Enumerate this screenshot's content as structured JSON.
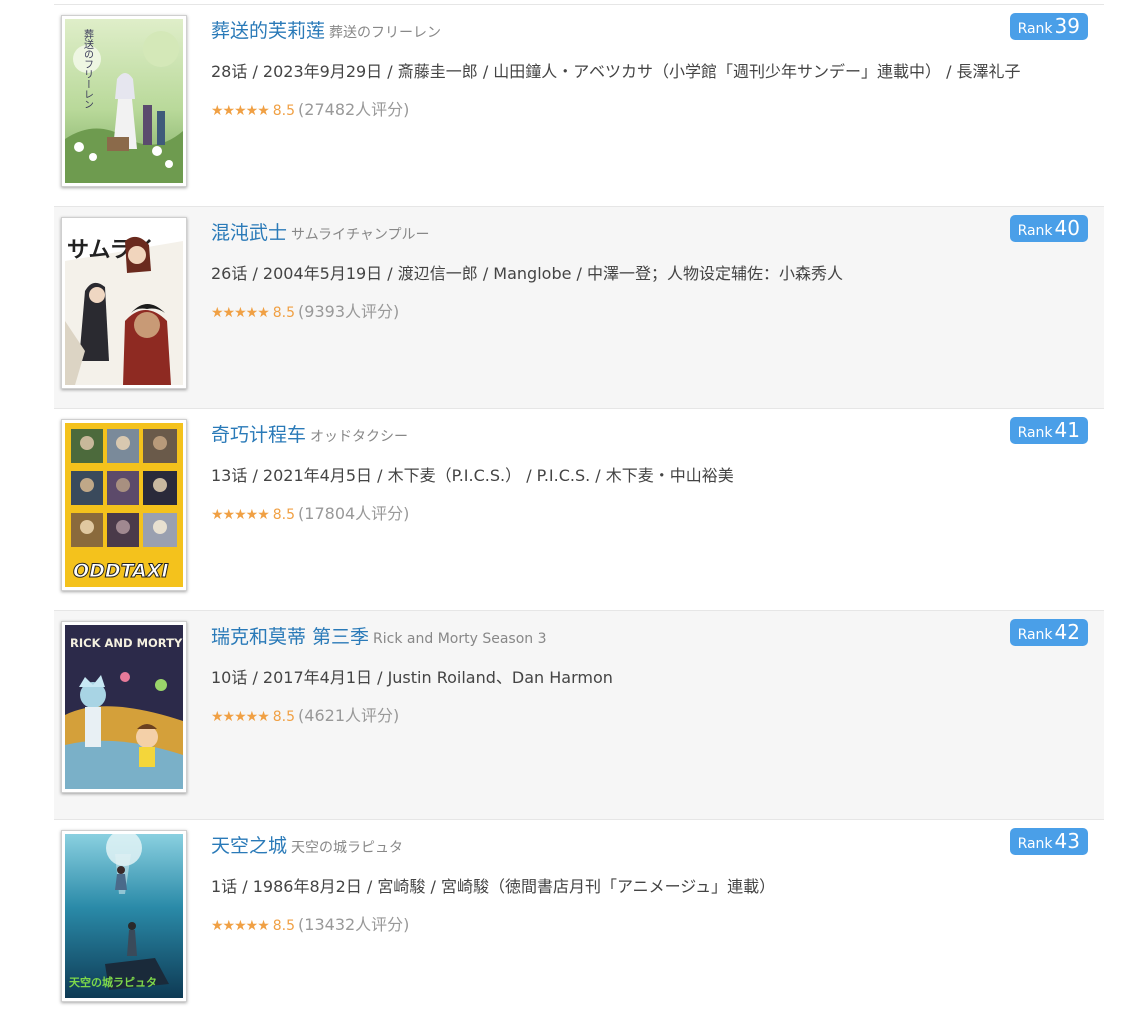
{
  "items": [
    {
      "title": "葬送的芙莉莲",
      "subtitle": "葬送のフリーレン",
      "meta": "28话 / 2023年9月29日 / 斎藤圭一郎 / 山田鐘人・アベツカサ（小学館「週刊少年サンデー」連載中） / 長澤礼子",
      "stars": "★★★★★",
      "score": "8.5",
      "votes": "(27482人评分)",
      "rank_label": "Rank",
      "rank": "39",
      "cover_text": "葬送のフリーレン"
    },
    {
      "title": "混沌武士",
      "subtitle": "サムライチャンプルー",
      "meta": "26话 / 2004年5月19日 / 渡辺信一郎 / Manglobe / 中澤一登；人物设定辅佐：小森秀人",
      "stars": "★★★★★",
      "score": "8.5",
      "votes": "(9393人评分)",
      "rank_label": "Rank",
      "rank": "40",
      "cover_text": "サムライ"
    },
    {
      "title": "奇巧计程车",
      "subtitle": "オッドタクシー",
      "meta": "13话 / 2021年4月5日 / 木下麦（P.I.C.S.） / P.I.C.S. / 木下麦・中山裕美",
      "stars": "★★★★★",
      "score": "8.5",
      "votes": "(17804人评分)",
      "rank_label": "Rank",
      "rank": "41",
      "cover_text": "ODDTAXI"
    },
    {
      "title": "瑞克和莫蒂 第三季",
      "subtitle": "Rick and Morty Season 3",
      "meta": "10话 / 2017年4月1日 / Justin Roiland、Dan Harmon",
      "stars": "★★★★★",
      "score": "8.5",
      "votes": "(4621人评分)",
      "rank_label": "Rank",
      "rank": "42",
      "cover_text": "RICK AND MORTY"
    },
    {
      "title": "天空之城",
      "subtitle": "天空の城ラピュタ",
      "meta": "1话 / 1986年8月2日 / 宮崎駿 / 宮崎駿（徳間書店月刊「アニメージュ」連載）",
      "stars": "★★★★★",
      "score": "8.5",
      "votes": "(13432人评分)",
      "rank_label": "Rank",
      "rank": "43",
      "cover_text": "天空の城ラピュタ"
    }
  ]
}
